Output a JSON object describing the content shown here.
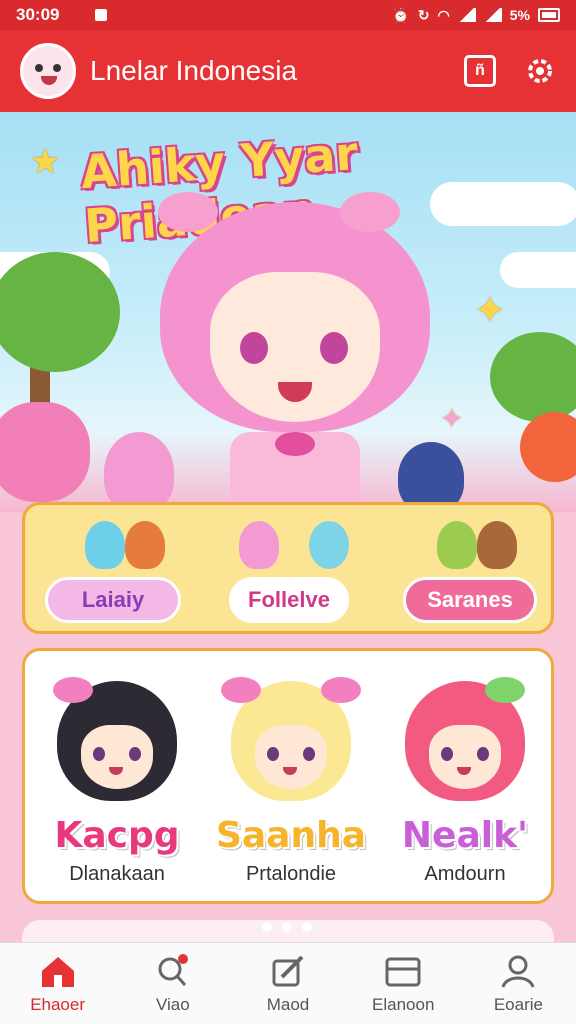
{
  "status_bar": {
    "time": "30:09",
    "battery": "5%"
  },
  "app_bar": {
    "title": "Lnelar Indonesia",
    "book_icon_glyph": "ñ"
  },
  "hero": {
    "banner_title": "Ahiky Yyar Priadean"
  },
  "categories": [
    {
      "label": "Laiaiy",
      "bg": "#f3b8e6",
      "color": "#8a3bb8"
    },
    {
      "label": "Follelve",
      "bg": "#ffffff",
      "color": "#d0398a"
    },
    {
      "label": "Saranes",
      "bg": "#f06a9a",
      "color": "#ffffff"
    }
  ],
  "characters": [
    {
      "name": "Kacpg",
      "subtitle": "Dlanakaan",
      "hair": "#2d2a33",
      "name_color": "#e8397e"
    },
    {
      "name": "Saanha",
      "subtitle": "Prtalondie",
      "hair": "#fbe892",
      "name_color": "#f6b42a"
    },
    {
      "name": "Nealk'",
      "subtitle": "Amdourn",
      "hair": "#f25a82",
      "name_color": "#c85fd6"
    }
  ],
  "bottom_nav": [
    {
      "label": "Ehaoer",
      "icon": "home-icon",
      "active": true
    },
    {
      "label": "Viao",
      "icon": "search-icon",
      "active": false
    },
    {
      "label": "Maod",
      "icon": "edit-icon",
      "active": false
    },
    {
      "label": "Elanoon",
      "icon": "inbox-icon",
      "active": false
    },
    {
      "label": "Eoarie",
      "icon": "profile-icon",
      "active": false
    }
  ],
  "colors": {
    "primary": "#e63234",
    "panel_yellow": "#fbe594",
    "panel_border": "#f1a83e",
    "background_pink": "#f9c6d8"
  }
}
